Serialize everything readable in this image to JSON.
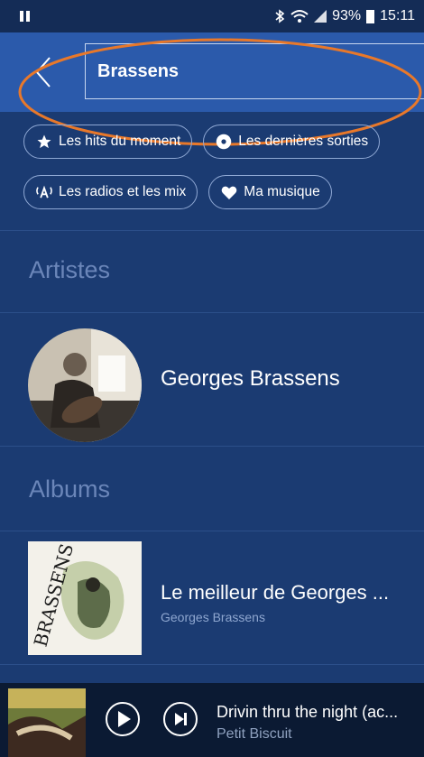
{
  "status_bar": {
    "battery": "93%",
    "time": "15:11"
  },
  "header": {
    "search_value": "Brassens"
  },
  "chips": [
    {
      "label": "Les hits du moment",
      "icon": "star-icon"
    },
    {
      "label": "Les dernières sorties",
      "icon": "disc-icon"
    },
    {
      "label": "Les radios et les mix",
      "icon": "radio-icon"
    },
    {
      "label": "Ma musique",
      "icon": "heart-icon"
    }
  ],
  "sections": {
    "artists_title": "Artistes",
    "albums_title": "Albums"
  },
  "artist": {
    "name": "Georges Brassens"
  },
  "album": {
    "title": "Le meilleur de Georges ...",
    "artist": "Georges Brassens",
    "cover_text": "BRASSENS"
  },
  "player": {
    "track_title": "Drivin thru the night (ac...",
    "track_artist": "Petit Biscuit"
  },
  "colors": {
    "background": "#1b3b72",
    "header": "#2b5aab",
    "player": "#0b1a33",
    "highlight": "#e8782a"
  }
}
